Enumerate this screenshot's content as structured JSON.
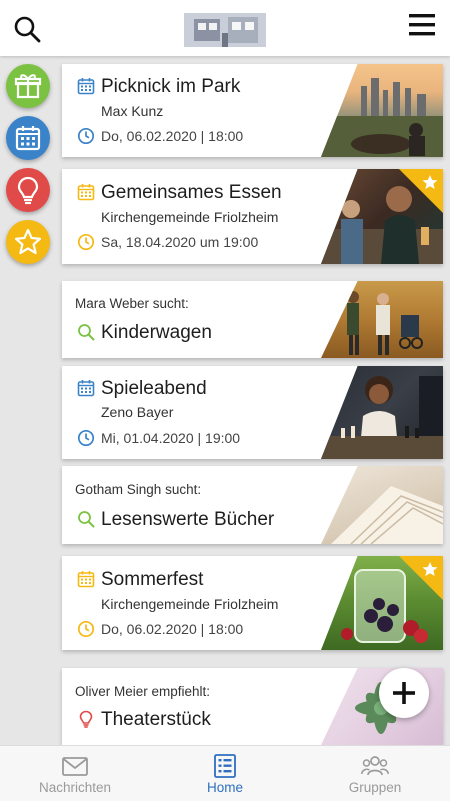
{
  "header": {
    "search_icon": "search-icon",
    "logo": "app-logo",
    "menu_icon": "hamburger-menu-icon"
  },
  "rail": [
    {
      "icon": "gift-icon",
      "color": "#7cc242"
    },
    {
      "icon": "calendar-icon",
      "color": "#3a83c9"
    },
    {
      "icon": "lightbulb-icon",
      "color": "#e04a48"
    },
    {
      "icon": "star-icon",
      "color": "#f5b914"
    }
  ],
  "cards": [
    {
      "type": "event",
      "title": "Picknick im Park",
      "subtitle": "Max Kunz",
      "date": "Do, 06.02.2020 | 18:00",
      "accent": "#3a83c9",
      "favorite": false
    },
    {
      "type": "event",
      "title": "Gemeinsames Essen",
      "subtitle": "Kirchengemeinde Friolzheim",
      "date": "Sa, 18.04.2020 um 19:00",
      "accent": "#f5b914",
      "favorite": true
    },
    {
      "type": "search",
      "who": "Mara Weber",
      "verb": " sucht:",
      "title": "Kinderwagen",
      "accent": "#7cc242"
    },
    {
      "type": "event",
      "title": "Spieleabend",
      "subtitle": "Zeno Bayer",
      "date": "Mi, 01.04.2020 | 19:00",
      "accent": "#3a83c9",
      "favorite": false
    },
    {
      "type": "search",
      "who": "Gotham Singh",
      "verb": " sucht:",
      "title": "Lesenswerte Bücher",
      "accent": "#7cc242"
    },
    {
      "type": "event",
      "title": "Sommerfest",
      "subtitle": "Kirchengemeinde Friolzheim",
      "date": "Do, 06.02.2020 | 18:00",
      "accent": "#f5b914",
      "favorite": true
    },
    {
      "type": "recommend",
      "who": "Oliver Meier",
      "verb": " empfiehlt:",
      "title": "Theaterstück",
      "accent": "#e04a48"
    }
  ],
  "fab": {
    "icon": "plus-icon"
  },
  "bottom_nav": [
    {
      "label": "Nachrichten",
      "icon": "mail-icon",
      "active": false
    },
    {
      "label": "Home",
      "icon": "home-list-icon",
      "active": true
    },
    {
      "label": "Gruppen",
      "icon": "groups-icon",
      "active": false
    }
  ]
}
